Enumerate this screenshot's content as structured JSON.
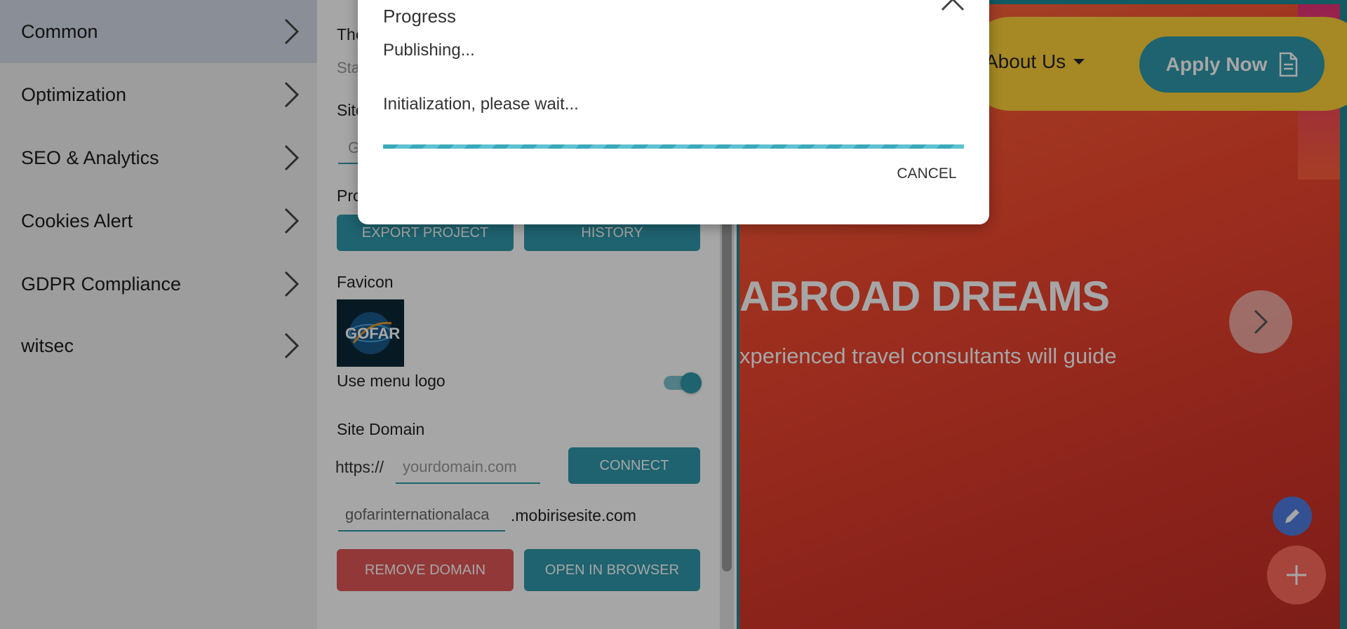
{
  "sidebar": {
    "items": [
      {
        "label": "Common"
      },
      {
        "label": "Optimization"
      },
      {
        "label": "SEO & Analytics"
      },
      {
        "label": "Cookies Alert"
      },
      {
        "label": "GDPR Compliance"
      },
      {
        "label": "witsec"
      }
    ]
  },
  "panel": {
    "partial_theme_label": "The",
    "partial_sta_text": "Sta",
    "partial_site_label": "Site",
    "partial_input_text": "G",
    "partial_project_label": "Pro",
    "export_button": "EXPORT PROJECT",
    "history_button": "HISTORY",
    "favicon_label": "Favicon",
    "favicon_logo_text": "GOFAR",
    "use_menu_logo_label": "Use menu logo",
    "use_menu_logo_on": true,
    "site_domain_label": "Site Domain",
    "https_prefix": "https://",
    "domain_placeholder": "yourdomain.com",
    "connect_button": "CONNECT",
    "subdomain_value": "gofarinternationalaca",
    "subdomain_suffix": ".mobirisesite.com",
    "remove_domain_button": "REMOVE DOMAIN",
    "open_browser_button": "OPEN IN BROWSER"
  },
  "preview": {
    "nav_about": "About Us",
    "apply_button": "Apply Now",
    "headline": "ABROAD DREAMS",
    "subline": "xperienced travel consultants will guide"
  },
  "modal": {
    "title": "Progress",
    "status": "Publishing...",
    "message": "Initialization, please wait...",
    "cancel_button": "CANCEL"
  },
  "colors": {
    "accent": "#2e98ab",
    "danger": "#e15658",
    "sidebar_active": "#d4dbe7"
  },
  "icons": {
    "nav_chevron": "chevron-right-icon",
    "modal_close": "chevron-up-icon",
    "apply": "document-icon",
    "slider": "chevron-right-icon",
    "edit": "pencil-icon",
    "add": "plus-icon"
  }
}
